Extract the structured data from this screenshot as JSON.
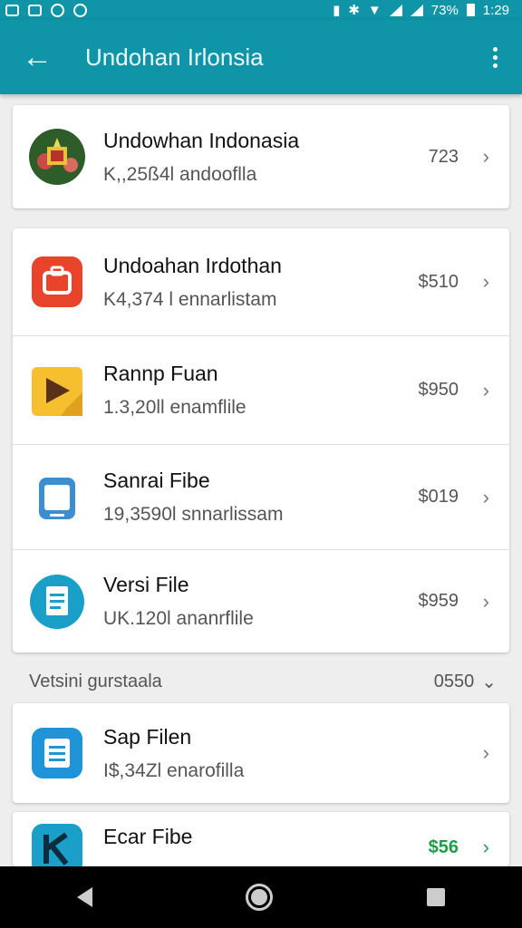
{
  "status": {
    "time": "1:29",
    "battery": "73%"
  },
  "appbar": {
    "title": "Undohan Irlonsia"
  },
  "items": [
    {
      "name": "Undowhan Indonasia",
      "sub": "K,,25ß4l andooflla",
      "price": "723",
      "icon": "flag-emblem-icon"
    },
    {
      "name": "Undoahan Irdothan",
      "sub": "K4,374 l ennarlistam",
      "price": "$510",
      "icon": "suitcase-icon"
    },
    {
      "name": "Rannp Fuan",
      "sub": "1.3,20ll enamflile",
      "price": "$950",
      "icon": "play-icon"
    },
    {
      "name": "Sanrai Fibe",
      "sub": "19,3590l snnarlissam",
      "price": "$019",
      "icon": "tablet-icon"
    },
    {
      "name": "Versi File",
      "sub": "UK.120l ananrflile",
      "price": "$959",
      "icon": "document-icon"
    },
    {
      "name": "Sap Filen",
      "sub": "I$,34Zl enarofilla",
      "price": "",
      "icon": "list-document-icon"
    },
    {
      "name": "Ecar Fibe",
      "sub": "",
      "price": "$56",
      "icon": "k-logo-icon"
    }
  ],
  "section": {
    "label": "Vetsini gurstaala",
    "value": "0550"
  },
  "colors": {
    "appbar": "#0f94a8",
    "accent_green": "#1f9d48"
  }
}
